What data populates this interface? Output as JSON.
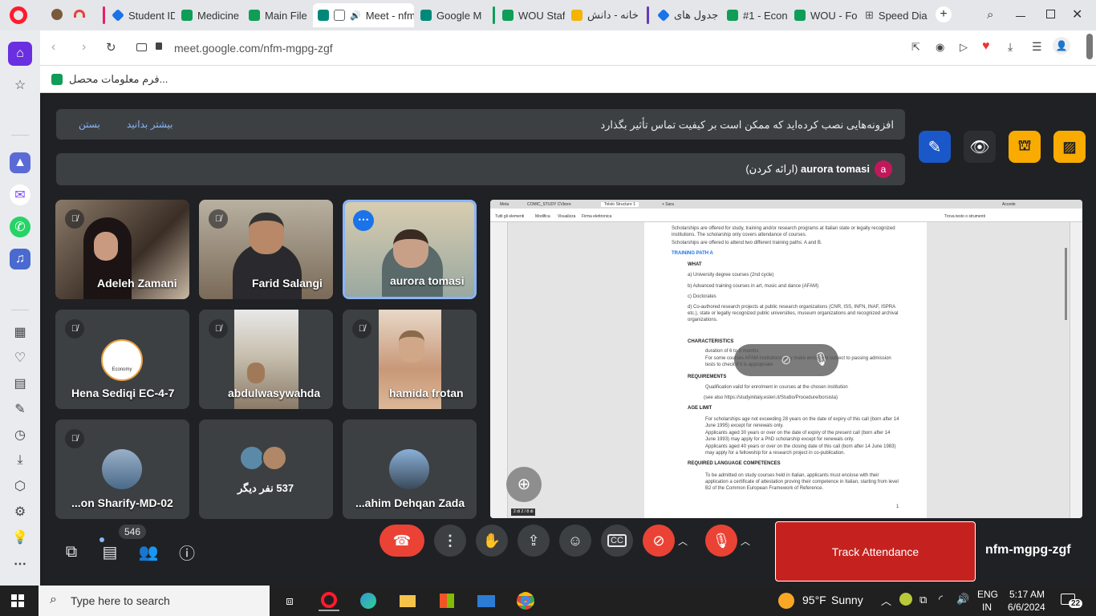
{
  "tabs": [
    {
      "label": "Student ID",
      "color": "#1a73e8"
    },
    {
      "label": "Medicine",
      "color": "#0f9d58"
    },
    {
      "label": "Main File",
      "color": "#0f9d58"
    },
    {
      "label": "Meet - nfm",
      "color": "#00897b"
    },
    {
      "label": "Google M",
      "color": "#00897b"
    },
    {
      "label": "WOU Staff",
      "color": "#0f9d58"
    },
    {
      "label": "خانه - دانش",
      "color": "#f4b400"
    },
    {
      "label": "جدول های",
      "color": "#1a73e8"
    },
    {
      "label": "#1 - Econ",
      "color": "#0f9d58"
    },
    {
      "label": "WOU - Fo",
      "color": "#0f9d58"
    },
    {
      "label": "Speed Dia",
      "color": "#777777"
    }
  ],
  "address": {
    "url": "meet.google.com/nfm-mgpg-zgf"
  },
  "bookmark": {
    "label": "فرم معلومات محصل..."
  },
  "banners": {
    "notice_text": "افزونه‌هایی نصب کرده‌اید که ممکن است بر کیفیت تماس تأثیر بگذارد",
    "learn_more": "بیشتر بدانید",
    "close": "بستن",
    "presenter_name": "aurora tomasi",
    "presenter_suffix": "(ارائه کردن)",
    "presenter_initial": "a"
  },
  "participants": [
    {
      "name": "Adeleh Zamani"
    },
    {
      "name": "Farid Salangi"
    },
    {
      "name": "aurora tomasi"
    },
    {
      "name": "Hena Sediqi EC-4-7",
      "logo_text": "Economy"
    },
    {
      "name": "abdulwasywahda"
    },
    {
      "name": "hamida frotan"
    },
    {
      "name": "...on Sharify-MD-02"
    },
    {
      "name": "537 نفر دیگر"
    },
    {
      "name": "...ahim Dehqan Zada"
    }
  ],
  "presentation": {
    "browser_tabs": [
      "Meta",
      "COMIC_STUDY CVbore",
      "Tolsto Structure 1",
      "+ Sara"
    ],
    "account": "Accede",
    "menu_items": [
      "Tutti gli elementi",
      "Modifica",
      "Visualizza",
      "Firma elettronica"
    ],
    "search_placeholder": "Trova testo o strumenti",
    "page_indicator": "2 di 2 / 8 di",
    "doc": {
      "intro": "Scholarships are offered for study, training and/or research programs at Italian state or legally recognized institutions. The scholarship only covers attendance of courses.",
      "paths": "Scholarships are offered to attend two different training paths: A and B.",
      "training_path": "TRAINING PATH A",
      "what": "WHAT",
      "what_a": "a) University degree courses (2nd cycle)",
      "what_b": "b) Advanced training courses in art, music and dance (AFAM)",
      "what_c": "c) Doctorates",
      "what_d": "d) Co-authored research projects at public research organizations (CNR, ISS, INFN, INAF, ISPRA etc.), state or legally recognized public universities, museum organizations and recognized archival organizations.",
      "characteristics": "CHARACTERISTICS",
      "char_1": "duration of 6 to 9 months",
      "char_2": "For some courses AFAM institutions may make enrolment subject to passing admission tests to check if it is appropriate",
      "requirements": "REQUIREMENTS",
      "req_1": "Qualification valid for enrolment in courses at the chosen institution",
      "req_2": "(see also https://studyinitaly.esteri.it/Studio/Procedure/borsista)",
      "age": "AGE LIMIT",
      "age_1": "For scholarships age not exceeding 28 years on the date of expiry of this call (born after 14 June 1995) except for renewals only.",
      "age_2": "Applicants aged 30 years or over on the date of expiry of the present call (born after 14 June 1993) may apply for a PhD scholarship except for renewals only.",
      "age_3": "Applicants aged 40 years or over on the closing date of this call (born after 14 June 1983) may apply for a fellowship for a research project in co-publication.",
      "lang": "REQUIRED LANGUAGE COMPETENCES",
      "lang_1": "To be admitted on study courses held in Italian, applicants must enclose with their application a certificate of attestation proving their competence in Italian, starting from level B2 of the Common European Framework of Reference.",
      "page_num": "1"
    }
  },
  "controls": {
    "participant_count": "546",
    "track_attendance": "Track Attendance",
    "meeting_code": "nfm-mgpg-zgf"
  },
  "taskbar": {
    "search_placeholder": "Type here to search",
    "temperature": "95°F",
    "weather": "Sunny",
    "lang_top": "ENG",
    "lang_bottom": "IN",
    "time": "5:17 AM",
    "date": "6/6/2024",
    "notifications": "22"
  },
  "colors": {
    "meet_bg": "#202124",
    "tile_bg": "#3c4043",
    "hangup": "#ea4335",
    "attendance": "#c5221f",
    "active_border": "#8ab4f8",
    "opera_red": "#ff1b2d"
  }
}
